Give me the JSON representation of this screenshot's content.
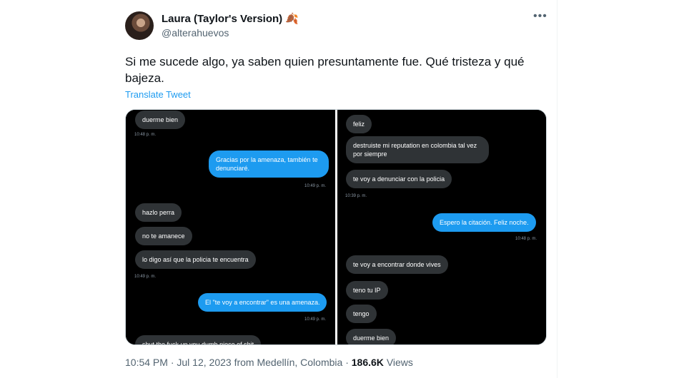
{
  "author": {
    "name": "Laura (Taylor's Version)",
    "name_emoji": "🍂",
    "handle": "@alterahuevos"
  },
  "tweet": {
    "more_label": "•••",
    "text": "Si me sucede algo, ya saben quien presuntamente fue. Qué tristeza y qué bajeza.",
    "translate_label": "Translate Tweet"
  },
  "screenshots": {
    "left": {
      "messages": [
        {
          "dir": "in",
          "text": "duerme bien"
        },
        {
          "ts": "10:48 p. m."
        },
        {
          "dir": "out",
          "text": "Gracias por la amenaza, también te denunciaré."
        },
        {
          "ts": "10:49 p. m."
        },
        {
          "dir": "in",
          "text": "hazlo perra"
        },
        {
          "dir": "in",
          "text": "no te amanece"
        },
        {
          "dir": "in",
          "text": "lo digo así que la policia te encuentra"
        },
        {
          "ts": "10:49 p. m."
        },
        {
          "dir": "out",
          "text": "El \"te voy a encontrar\" es una amenaza."
        },
        {
          "ts": "10:49 p. m."
        },
        {
          "dir": "in",
          "text": "shut the fuck up you dumb piece of shit"
        }
      ]
    },
    "right": {
      "messages": [
        {
          "dir": "in",
          "text": "feliz"
        },
        {
          "dir": "in",
          "text": "destruiste mi reputation en colombia tal vez por siempre"
        },
        {
          "dir": "in",
          "text": "te voy a denunciar con la policia"
        },
        {
          "ts": "10:39 p. m."
        },
        {
          "dir": "out",
          "text": "Espero la citación. Feliz noche."
        },
        {
          "ts": "10:48 p. m."
        },
        {
          "dir": "in",
          "text": "te voy a encontrar donde vives"
        },
        {
          "dir": "in",
          "text": "teno tu IP"
        },
        {
          "dir": "in",
          "text": "tengo"
        },
        {
          "dir": "in",
          "text": "duerme bien"
        }
      ]
    }
  },
  "footer": {
    "time": "10:54 PM",
    "date": "Jul 12, 2023",
    "location": "from Medellín, Colombia",
    "views_count": "186.6K",
    "views_label": "Views"
  },
  "colors": {
    "accent": "#1d9bf0",
    "incoming_bubble": "#2f3336",
    "outgoing_bubble": "#1d9bf0",
    "screenshot_bg": "#000000"
  }
}
